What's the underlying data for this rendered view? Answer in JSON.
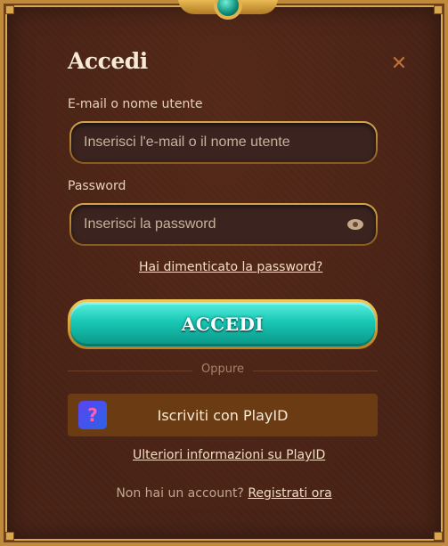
{
  "dialog": {
    "title": "Accedi",
    "close_symbol": "✕"
  },
  "email": {
    "label": "E-mail o nome utente",
    "placeholder": "Inserisci l'e-mail o il nome utente",
    "value": ""
  },
  "password": {
    "label": "Password",
    "placeholder": "Inserisci la password",
    "value": ""
  },
  "links": {
    "forgot": "Hai dimenticato la password?",
    "playid_info": "Ulteriori informazioni su PlayID"
  },
  "login_button": "ACCEDI",
  "divider": "Oppure",
  "playid": {
    "label": "Iscriviti con PlayID",
    "logo_glyph": "?"
  },
  "footer": {
    "text": "Non hai un account?",
    "register": "Registrati ora"
  },
  "icons": {
    "close": "close-icon",
    "eye": "eye-icon",
    "playid": "playid-logo-icon",
    "emblem": "winged-gem-emblem"
  },
  "colors": {
    "background": "#4a2417",
    "border_gold": "#c08a3a",
    "button_teal": "#18c7b4",
    "playid_button": "#6b3c14",
    "close_orange": "#c0703a"
  }
}
